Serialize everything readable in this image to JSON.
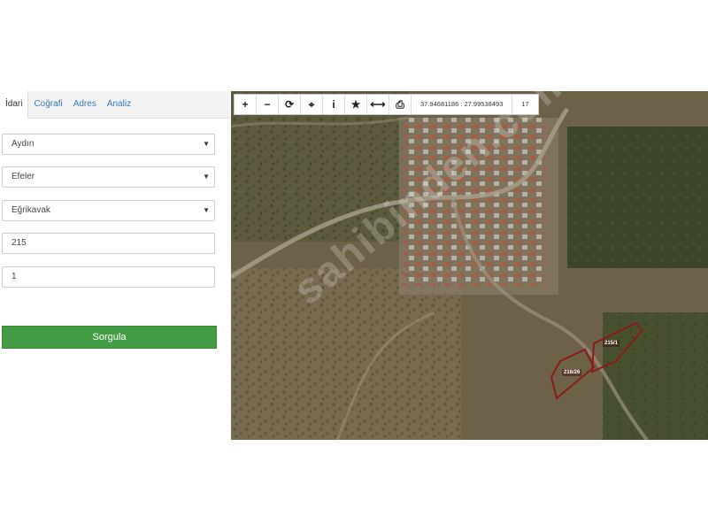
{
  "tabs": [
    {
      "label": "İdari",
      "active": true
    },
    {
      "label": "Coğrafi",
      "active": false
    },
    {
      "label": "Adres",
      "active": false
    },
    {
      "label": "Analiz",
      "active": false
    }
  ],
  "form": {
    "province": "Aydın",
    "district": "Efeler",
    "neighborhood": "Eğrikavak",
    "block": "215",
    "parcel": "1",
    "query_button": "Sorgula"
  },
  "map": {
    "coordinates": "37.94681186 : 27.99538493",
    "zoom_level": "17",
    "watermark": "sahibinden.com",
    "parcels": [
      {
        "label": "215/1"
      },
      {
        "label": "216/26"
      }
    ],
    "tools": [
      "zoom-in-icon",
      "zoom-out-icon",
      "refresh-icon",
      "locate-icon",
      "info-icon",
      "star-icon",
      "measure-icon",
      "print-icon"
    ],
    "colors": {
      "parcel_outline": "#8b1a1a",
      "accent": "#449d44",
      "link": "#337ab7"
    }
  }
}
